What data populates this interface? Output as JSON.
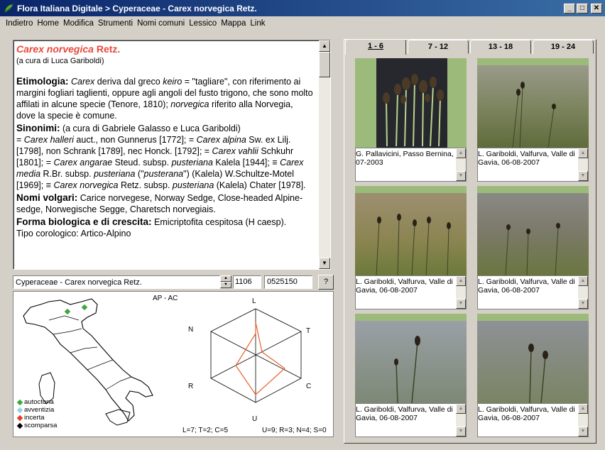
{
  "window": {
    "title": "Flora Italiana Digitale > Cyperaceae - Carex norvegica Retz.",
    "controls": {
      "minimize": "_",
      "maximize": "□",
      "close": "✕"
    }
  },
  "menu": [
    "Indietro",
    "Home",
    "Modifica",
    "Strumenti",
    "Nomi comuni",
    "Lessico",
    "Mappa",
    "Link"
  ],
  "description": {
    "species_italic": "Carex norvegica",
    "species_author": " Retz.",
    "byline": "(a cura di Luca Gariboldi)",
    "etimologia_heading": "Etimologia:",
    "etimologia_1": " Carex",
    "etimologia_2": " deriva dal greco ",
    "etimologia_3": "keiro",
    "etimologia_4": " = \"tagliare\", con riferimento ai margini fogliari taglienti, oppure agli angoli del fusto trigono, che sono molto affilati in alcune specie (Tenore, 1810); ",
    "etimologia_5": "norvegica",
    "etimologia_6": " riferito alla Norvegia, dove la specie è comune.",
    "sinonimi_heading": "Sinonimi:",
    "sinonimi_by": " (a cura di Gabriele Galasso e Luca Gariboldi)",
    "sin_1": "= ",
    "sin_2": "Carex halleri",
    "sin_3": " auct., non Gunnerus [1772]; = ",
    "sin_4": "Carex alpina",
    "sin_5": " Sw. ex Lilj. [1798], non Schrank [1789], nec Honck. [1792]; = ",
    "sin_6": "Carex vahlii",
    "sin_7": " Schkuhr [1801]; = ",
    "sin_8": "Carex angarae",
    "sin_9": " Steud. subsp. ",
    "sin_10": "pusteriana",
    "sin_11": " Kalela [1944]; ≡ ",
    "sin_12": "Carex media",
    "sin_13": " R.Br. subsp. ",
    "sin_14": "pusteriana",
    "sin_15": " (\"",
    "sin_16": "pusterana",
    "sin_17": "\") (Kalela) W.Schultze-Motel [1969]; ≡ ",
    "sin_18": "Carex norvegica",
    "sin_19": " Retz. subsp. ",
    "sin_20": "pusteriana",
    "sin_21": " (Kalela) Chater [1978].",
    "volgari_heading": "Nomi volgari:",
    "volgari_text": " Carice norvegese, Norway Sedge, Close-headed Alpine-sedge, Norwegische Segge, Charetsch norvegiais.",
    "forma_heading": "Forma biologica e di crescita:",
    "forma_text": " Emicriptofita cespitosa (H caesp).",
    "cut_line": "Tipo corologico: Artico-Alpino"
  },
  "search": {
    "value": "Cyperaceae - Carex norvegica Retz.",
    "code1": "1106",
    "code2": "0525150",
    "help": "?"
  },
  "map": {
    "region_label": "AP - AC",
    "legend": [
      {
        "label": "autoctona",
        "color": "#3aa83a"
      },
      {
        "label": "avventizia",
        "color": "#8fd6e8"
      },
      {
        "label": "incerta",
        "color": "#e83a2a"
      },
      {
        "label": "scomparsa",
        "color": "#000000"
      }
    ],
    "hex_labels": {
      "L": "L",
      "T": "T",
      "C": "C",
      "U": "U",
      "R": "R",
      "N": "N"
    },
    "indices_left": "L=7; T=2; C=5",
    "indices_right": "U=9; R=3; N=4; S=0",
    "accent": "#e8602c"
  },
  "gallery": {
    "tabs": [
      "1 - 6",
      "7 - 12",
      "13 - 18",
      "19 - 24"
    ],
    "active_tab": 0,
    "photos": [
      {
        "caption": "G. Pallavicini, Passo Bernina, 07-2003"
      },
      {
        "caption": "L. Gariboldi, Valfurva, Valle di Gavia, 06-08-2007"
      },
      {
        "caption": "L. Gariboldi, Valfurva, Valle di Gavia, 06-08-2007"
      },
      {
        "caption": "L. Gariboldi, Valfurva, Valle di Gavia, 06-08-2007"
      },
      {
        "caption": "L. Gariboldi, Valfurva, Valle di Gavia, 06-08-2007"
      },
      {
        "caption": "L. Gariboldi, Valfurva, Valle di Gavia, 06-08-2007"
      }
    ]
  }
}
